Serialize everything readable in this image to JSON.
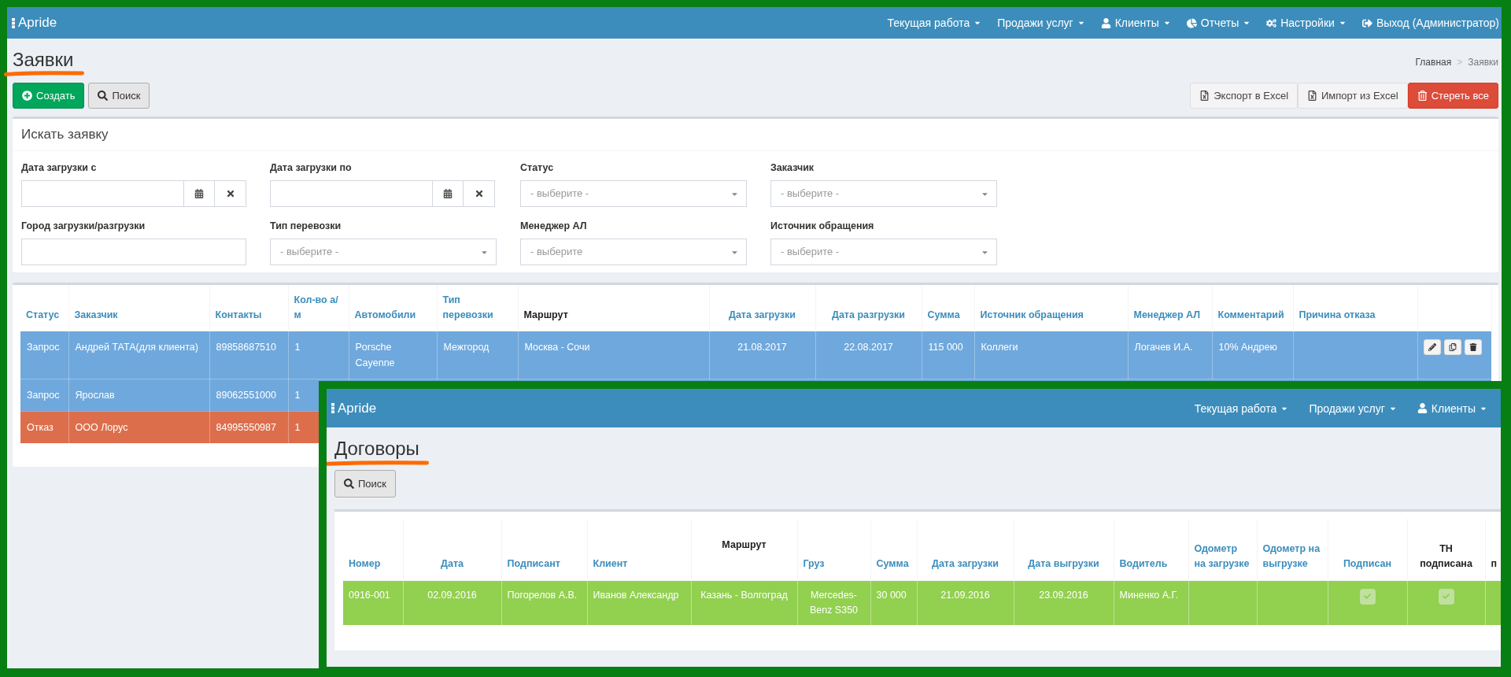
{
  "main_window": {
    "navbar": {
      "brand": "Apride",
      "menu": [
        {
          "label": "Текущая работа",
          "dropdown": true
        },
        {
          "label": "Продажи услуг",
          "dropdown": true
        },
        {
          "label": "Клиенты",
          "dropdown": true
        },
        {
          "label": "Отчеты",
          "dropdown": true
        },
        {
          "label": "Настройки",
          "dropdown": true
        },
        {
          "label": "Выход (Администратор)",
          "dropdown": false
        }
      ]
    },
    "page_title": "Заявки",
    "breadcrumb": {
      "separator": ">",
      "items": [
        {
          "label": "Главная",
          "selected": false
        },
        {
          "label": "Заявки",
          "selected": true
        }
      ]
    },
    "toolbar_left": [
      {
        "label": "Создать",
        "kind": "success"
      },
      {
        "label": "Поиск",
        "kind": "secondary"
      }
    ],
    "toolbar_right": [
      {
        "label": "Экспорт в Excel",
        "kind": "default"
      },
      {
        "label": "Импорт из Excel",
        "kind": "default"
      },
      {
        "label": "Стереть все",
        "kind": "danger"
      }
    ],
    "search_panel": {
      "title": "Искать заявку",
      "fields": [
        {
          "label": "Дата загрузки с",
          "kind": "date"
        },
        {
          "label": "Дата загрузки по",
          "kind": "date"
        },
        {
          "label": "Статус",
          "kind": "select",
          "placeholder": "- выберите -"
        },
        {
          "label": "Заказчик",
          "kind": "select",
          "placeholder": "- выберите -"
        },
        {
          "label": "Город загрузки/разгрузки",
          "kind": "text"
        },
        {
          "label": "Тип перевозки",
          "kind": "select",
          "placeholder": "- выберите -"
        },
        {
          "label": "Менеджер АЛ",
          "kind": "select",
          "placeholder": "- выберите"
        },
        {
          "label": "Источник обращения",
          "kind": "select",
          "placeholder": "- выберите -"
        }
      ]
    },
    "table": {
      "columns": [
        {
          "label": "Статус",
          "sortable": true
        },
        {
          "label": "Заказчик",
          "sortable": true
        },
        {
          "label": "Контакты",
          "sortable": true
        },
        {
          "label": "Кол-во а/м",
          "sortable": true
        },
        {
          "label": "Автомобили",
          "sortable": true
        },
        {
          "label": "Тип перевозки",
          "sortable": true
        },
        {
          "label": "Маршрут",
          "sortable": false
        },
        {
          "label": "Дата загрузки",
          "sortable": true
        },
        {
          "label": "Дата разгрузки",
          "sortable": true
        },
        {
          "label": "Сумма",
          "sortable": true
        },
        {
          "label": "Источник обращения",
          "sortable": true
        },
        {
          "label": "Менеджер АЛ",
          "sortable": true
        },
        {
          "label": "Комментарий",
          "sortable": true
        },
        {
          "label": "Причина отказа",
          "sortable": true
        }
      ],
      "rows": [
        {
          "color": "#6fa8dc",
          "actions": true,
          "cells": {
            "status": "Запрос",
            "customer": "Андрей ТАТА(для клиента)",
            "contacts": "89858687510",
            "vehicle_count": "1",
            "cars": "Porsche Cayenne",
            "transport_type": "Межгород",
            "route": "Москва - Сочи",
            "load_date": "21.08.2017",
            "unload_date": "22.08.2017",
            "amount": "115 000",
            "source": "Коллеги",
            "manager": "Логачев И.А.",
            "comment": "10% Андрею"
          }
        },
        {
          "color": "#6fa8dc",
          "cells": {
            "status": "Запрос",
            "customer": "Ярослав",
            "contacts": "89062551000",
            "vehicle_count": "1"
          }
        },
        {
          "color": "#dd6e4c",
          "cells": {
            "status": "Отказ",
            "customer": "ООО Лорус",
            "contacts": "84995550987",
            "vehicle_count": "1"
          }
        }
      ]
    }
  },
  "inset_window": {
    "navbar": {
      "brand": "Apride",
      "menu": [
        {
          "label": "Текущая работа",
          "dropdown": true
        },
        {
          "label": "Продажи услуг",
          "dropdown": true
        },
        {
          "label": "Клиенты",
          "dropdown": true
        }
      ]
    },
    "page_title": "Договоры",
    "toolbar": [
      {
        "label": "Поиск",
        "kind": "secondary"
      }
    ],
    "table": {
      "columns": [
        {
          "label": "Номер",
          "sortable": true
        },
        {
          "label": "Дата",
          "sortable": true
        },
        {
          "label": "Подписант",
          "sortable": true
        },
        {
          "label": "Клиент",
          "sortable": true
        },
        {
          "label": "Маршрут",
          "sortable": false
        },
        {
          "label": "Груз",
          "sortable": true
        },
        {
          "label": "Сумма",
          "sortable": true
        },
        {
          "label": "Дата загрузки",
          "sortable": true
        },
        {
          "label": "Дата выгрузки",
          "sortable": true
        },
        {
          "label": "Водитель",
          "sortable": true
        },
        {
          "label": "Одометр на загрузке",
          "sortable": true
        },
        {
          "label": "Одометр на выгрузке",
          "sortable": true
        },
        {
          "label": "Подписан",
          "sortable": true
        },
        {
          "label": "ТН подписана",
          "sortable": false
        },
        {
          "label": "п",
          "sortable": false
        }
      ],
      "rows": [
        {
          "color": "#92d050",
          "cells": {
            "number": "0916-001",
            "date": "02.09.2016",
            "signer": "Погорелов А.В.",
            "client": "Иванов Александр",
            "route": "Казань - Волгоград",
            "cargo": "Mercedes-Benz S350",
            "amount": "30 000",
            "load_date": "21.09.2016",
            "unload_date": "23.09.2016",
            "driver": "Миненко А.Г.",
            "signed": true,
            "tn_signed": true
          }
        }
      ]
    }
  }
}
